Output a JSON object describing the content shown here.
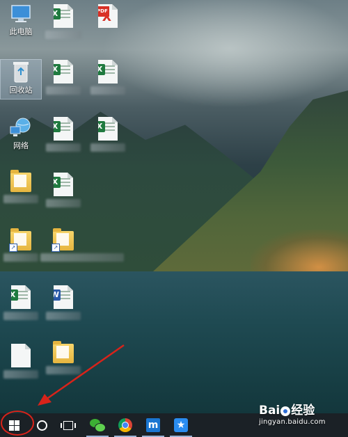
{
  "desktop": {
    "icons": [
      {
        "label": "此电脑",
        "type": "computer"
      },
      {
        "label": "回收站",
        "type": "recycle-bin"
      },
      {
        "label": "网络",
        "type": "network"
      }
    ]
  },
  "taskbar": {
    "items": [
      "start",
      "search",
      "task-view",
      "wechat",
      "chrome",
      "maxthon",
      "pinned-app"
    ]
  },
  "watermark": {
    "brand": "Bai",
    "brand_suffix": "经验",
    "url": "jingyan.baidu.com"
  },
  "annotation": {
    "color": "#d8231a"
  },
  "colors": {
    "taskbar": "#1b2126",
    "excel": "#1f7a3f",
    "word": "#2a5aa8",
    "pdf": "#d93025"
  }
}
